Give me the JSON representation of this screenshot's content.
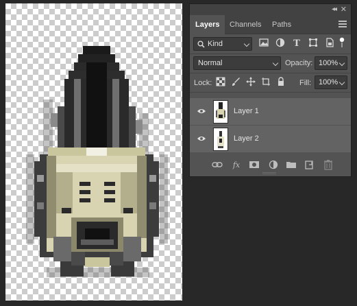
{
  "panel": {
    "tabs": [
      {
        "label": "Layers",
        "active": true
      },
      {
        "label": "Channels",
        "active": false
      },
      {
        "label": "Paths",
        "active": false
      }
    ]
  },
  "filter": {
    "kind_label": "Kind",
    "icons": [
      "image-filter-icon",
      "adjustment-filter-icon",
      "type-filter-icon",
      "shape-filter-icon",
      "smart-object-filter-icon",
      "filter-toggle-icon"
    ]
  },
  "blend": {
    "mode": "Normal",
    "opacity_label": "Opacity:",
    "opacity_value": "100%"
  },
  "lock": {
    "label": "Lock:",
    "fill_label": "Fill:",
    "fill_value": "100%"
  },
  "layers": [
    {
      "name": "Layer 1",
      "visible": true
    },
    {
      "name": "Layer 2",
      "visible": true
    }
  ],
  "footer_icons": [
    "link-layers-icon",
    "fx-icon",
    "add-mask-icon",
    "new-adjustment-icon",
    "new-group-icon",
    "new-layer-icon",
    "delete-layer-icon"
  ],
  "colors": {
    "panel_bg": "#535353",
    "tab_bar_bg": "#424242",
    "workspace_bg": "#282828",
    "layer_row_bg": "#636363"
  }
}
